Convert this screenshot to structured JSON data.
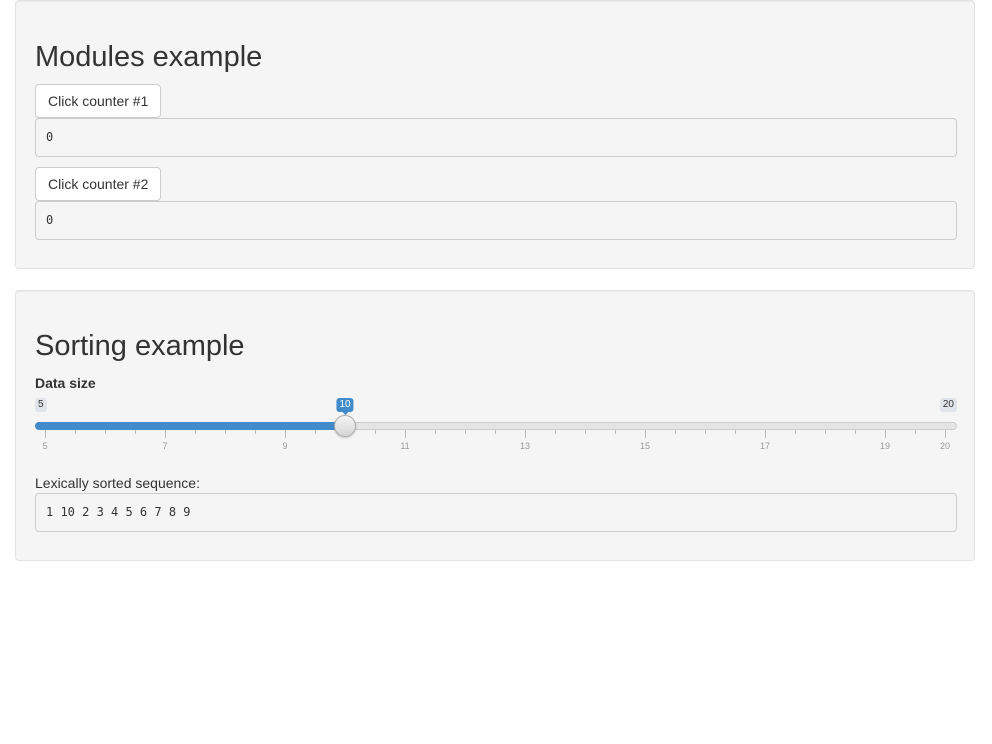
{
  "modules": {
    "title": "Modules example",
    "counters": [
      {
        "button_label": "Click counter #1",
        "value": "0"
      },
      {
        "button_label": "Click counter #2",
        "value": "0"
      }
    ]
  },
  "sorting": {
    "title": "Sorting example",
    "slider": {
      "label": "Data size",
      "min": 5,
      "max": 20,
      "value": 10,
      "min_label": "5",
      "max_label": "20",
      "value_label": "10",
      "major_ticks": [
        "5",
        "7",
        "9",
        "11",
        "13",
        "15",
        "17",
        "19",
        "20"
      ]
    },
    "output_label": "Lexically sorted sequence:",
    "output_value": "1 10 2 3 4 5 6 7 8 9"
  },
  "colors": {
    "accent": "#428bca",
    "well_background": "#f5f5f5",
    "border": "#cccccc"
  }
}
